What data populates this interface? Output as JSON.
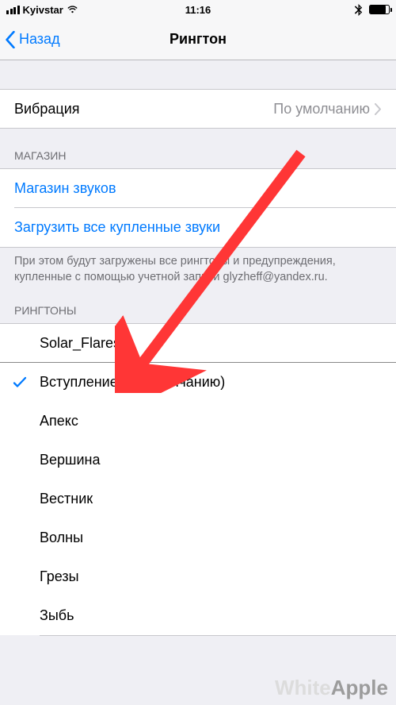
{
  "status_bar": {
    "carrier": "Kyivstar",
    "time": "11:16"
  },
  "nav": {
    "back_label": "Назад",
    "title": "Рингтон"
  },
  "vibration": {
    "label": "Вибрация",
    "value": "По умолчанию"
  },
  "store_section": {
    "header": "МАГАЗИН",
    "store_link": "Магазин звуков",
    "download_link": "Загрузить все купленные звуки",
    "footer": "При этом будут загружены все рингтоны и предупреждения, купленные с помощью учетной записи glyzheff@yandex.ru."
  },
  "ringtones_section": {
    "header": "РИНГТОНЫ",
    "custom": "Solar_Flares",
    "items": [
      {
        "label": "Вступление (по умолчанию)",
        "selected": true
      },
      {
        "label": "Апекс",
        "selected": false
      },
      {
        "label": "Вершина",
        "selected": false
      },
      {
        "label": "Вестник",
        "selected": false
      },
      {
        "label": "Волны",
        "selected": false
      },
      {
        "label": "Грезы",
        "selected": false
      },
      {
        "label": "Зыбь",
        "selected": false
      }
    ]
  },
  "watermark": {
    "part1": "White",
    "part2": "Apple"
  },
  "colors": {
    "link": "#007aff",
    "arrow": "#ff3636"
  }
}
